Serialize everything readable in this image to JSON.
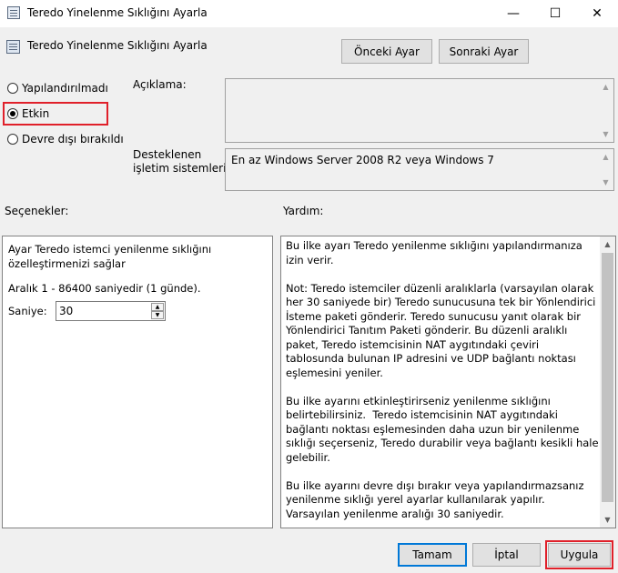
{
  "window": {
    "title": "Teredo Yinelenme Sıklığını Ayarla",
    "min_glyph": "—",
    "max_glyph": "☐",
    "close_glyph": "✕"
  },
  "header": {
    "title": "Teredo Yinelenme Sıklığını Ayarla",
    "prev_button": "Önceki Ayar",
    "next_button": "Sonraki Ayar"
  },
  "state": {
    "options": [
      {
        "label": "Yapılandırılmadı",
        "checked": false
      },
      {
        "label": "Etkin",
        "checked": true
      },
      {
        "label": "Devre dışı bırakıldı",
        "checked": false
      }
    ]
  },
  "description": {
    "label": "Açıklama:",
    "value": ""
  },
  "supported": {
    "label_line1": "Desteklenen",
    "label_line2": "işletim sistemleri:",
    "value": "En az Windows Server 2008 R2 veya Windows 7"
  },
  "options_section": {
    "label": "Seçenekler:",
    "line1": "Ayar Teredo istemci yenilenme sıklığını",
    "line2": "özelleştirmenizi sağlar",
    "range": "Aralık 1 - 86400 saniyedir (1 günde).",
    "seconds_label": "Saniye:",
    "seconds_value": "30"
  },
  "help": {
    "label": "Yardım:",
    "text": "Bu ilke ayarı Teredo yenilenme sıklığını yapılandırmanıza izin verir.\n\nNot: Teredo istemciler düzenli aralıklarla (varsayılan olarak her 30 saniyede bir) Teredo sunucusuna tek bir Yönlendirici İsteme paketi gönderir. Teredo sunucusu yanıt olarak bir Yönlendirici Tanıtım Paketi gönderir. Bu düzenli aralıklı paket, Teredo istemcisinin NAT aygıtındaki çeviri tablosunda bulunan IP adresini ve UDP bağlantı noktası eşlemesini yeniler.\n\nBu ilke ayarını etkinleştirirseniz yenilenme sıklığını belirtebilirsiniz.  Teredo istemcisinin NAT aygıtındaki bağlantı noktası eşlemesinden daha uzun bir yenilenme sıklığı seçerseniz, Teredo durabilir veya bağlantı kesikli hale gelebilir.\n\nBu ilke ayarını devre dışı bırakır veya yapılandırmazsanız yenilenme sıklığı yerel ayarlar kullanılarak yapılır. Varsayılan yenilenme aralığı 30 saniyedir."
  },
  "footer": {
    "ok": "Tamam",
    "cancel": "İptal",
    "apply": "Uygula"
  },
  "colors": {
    "highlight": "#e0202a",
    "default_button_border": "#0078d7"
  }
}
